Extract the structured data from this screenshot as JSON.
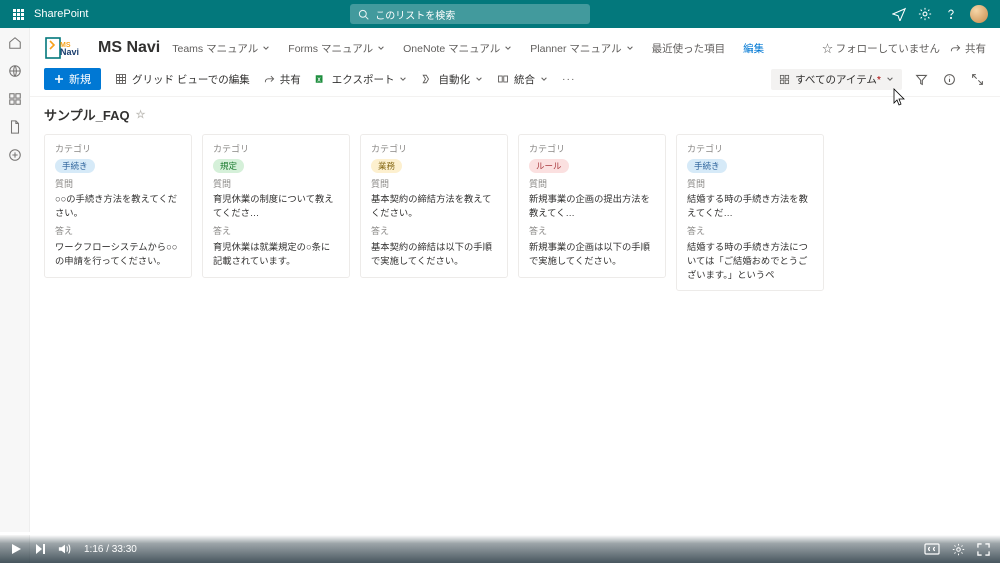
{
  "suite": {
    "brand": "SharePoint",
    "search_placeholder": "このリストを検索"
  },
  "site": {
    "logo_text": "MSNavi",
    "title": "MS Navi",
    "follow": "☆ フォローしていません",
    "share": "共有"
  },
  "hubnav": {
    "items": [
      "Teams マニュアル",
      "Forms マニュアル",
      "OneNote マニュアル",
      "Planner マニュアル"
    ],
    "recent": "最近使った項目",
    "edit": "編集"
  },
  "cmdbar": {
    "new": "新規",
    "grid": "グリッド ビューでの編集",
    "share": "共有",
    "export": "エクスポート",
    "automate": "自動化",
    "integrate": "統合",
    "view": "すべてのアイテム"
  },
  "list": {
    "title": "サンプル_FAQ"
  },
  "labels": {
    "category": "カテゴリ",
    "question": "質問",
    "answer": "答え"
  },
  "cards": [
    {
      "pill_text": "手続き",
      "pill_class": "blue",
      "q": "○○の手続き方法を教えてください。",
      "a": "ワークフローシステムから○○の申請を行ってください。"
    },
    {
      "pill_text": "規定",
      "pill_class": "green",
      "q": "育児休業の制度について教えてくださ…",
      "a": "育児休業は就業規定の○条に記載されています。"
    },
    {
      "pill_text": "業務",
      "pill_class": "yellow",
      "q": "基本契約の締結方法を教えてください。",
      "a": "基本契約の締結は以下の手順で実施してください。"
    },
    {
      "pill_text": "ルール",
      "pill_class": "red",
      "q": "新規事業の企画の提出方法を教えてく…",
      "a": "新規事業の企画は以下の手順で実施してください。"
    },
    {
      "pill_text": "手続き",
      "pill_class": "blue",
      "q": "結婚する時の手続き方法を教えてくだ…",
      "a": "結婚する時の手続き方法については「ご結婚おめでとうございます。」というペ"
    }
  ],
  "player": {
    "time": "1:16 / 33:30"
  }
}
